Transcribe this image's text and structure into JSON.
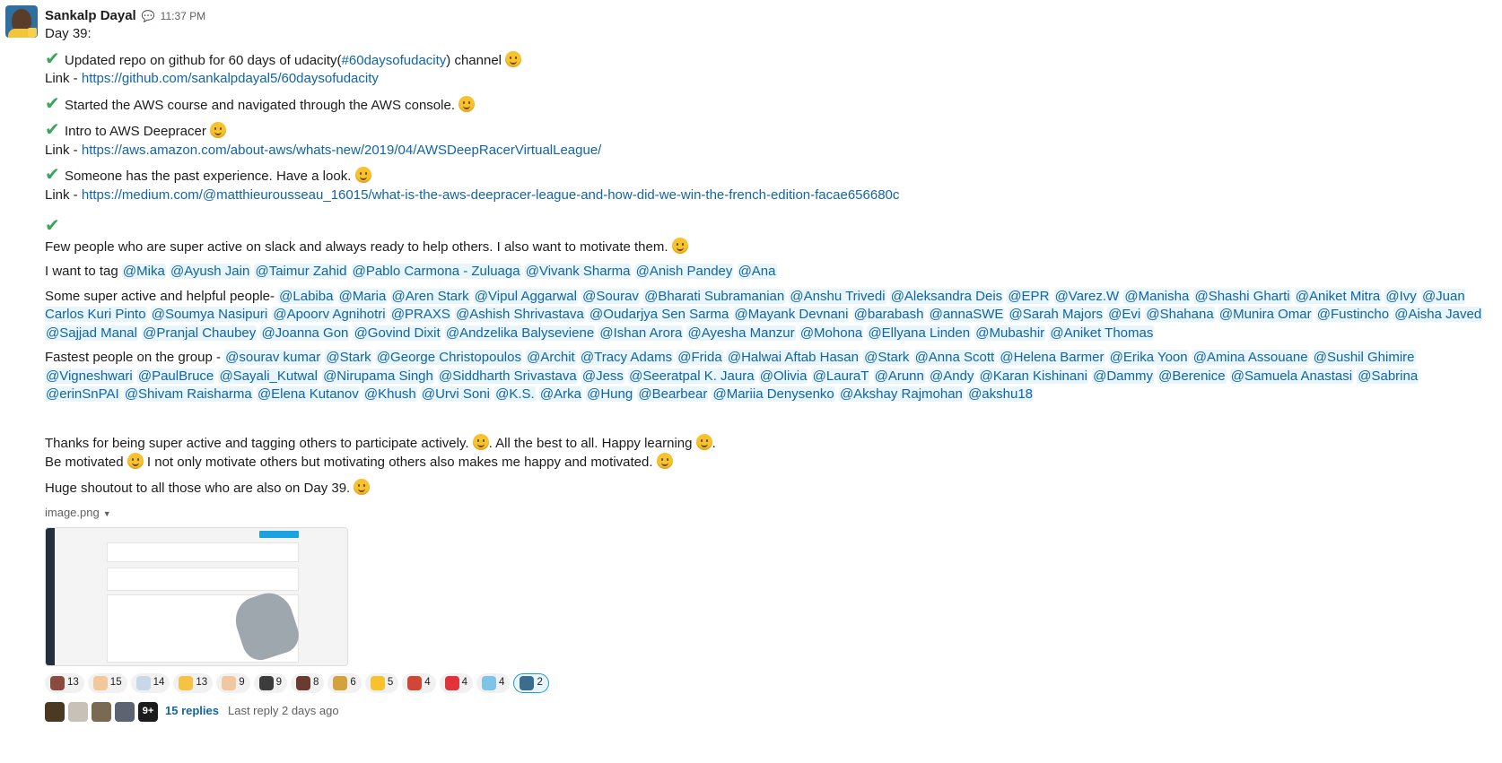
{
  "author": "Sankalp Dayal",
  "time": "11:37 PM",
  "day": "Day 39:",
  "lines": {
    "l1a": "Updated repo on github for 60 days of udacity(",
    "l1chan": "#60daysofudacity",
    "l1b": ")  channel",
    "link_label": "Link - ",
    "link1": "https://github.com/sankalpdayal5/60daysofudacity",
    "l2": "Started the AWS course and navigated through the AWS console.",
    "l3": "Intro to AWS Deepracer",
    "link2": "https://aws.amazon.com/about-aws/whats-new/2019/04/AWSDeepRacerVirtualLeague/",
    "l4": "Someone has the past experience. Have a look.",
    "link3": "https://medium.com/@matthieurousseau_16015/what-is-the-aws-deepracer-league-and-how-did-we-win-the-french-edition-facae656680c",
    "l5": "Few people who are super active on slack and always ready to help others. I also want to motivate them.",
    "tag_intro": "I want to tag",
    "helpful_intro": "Some super active and helpful people-",
    "fastest_intro": "Fastest people on the group -",
    "thanks_a": "Thanks for being super active and tagging others to participate actively.",
    "thanks_b": ". All the best to all. Happy learning",
    "thanks_c": ".",
    "motivated_a": "Be motivated",
    "motivated_b": " I not only motivate others but motivating others also makes me happy and motivated.",
    "shoutout": "Huge shoutout to all those who are also on Day 39."
  },
  "tags": [
    "@Mika",
    "@Ayush Jain",
    "@Taimur Zahid",
    "@Pablo Carmona - Zuluaga",
    "@Vivank Sharma",
    "@Anish Pandey",
    "@Ana"
  ],
  "helpful": [
    "@Labiba",
    "@Maria",
    "@Aren Stark",
    "@Vipul Aggarwal",
    "@Sourav",
    "@Bharati Subramanian",
    "@Anshu Trivedi",
    "@Aleksandra Deis",
    "@EPR",
    "@Varez.W",
    "@Manisha",
    "@Shashi Gharti",
    "@Aniket Mitra",
    "@Ivy",
    "@Juan Carlos Kuri Pinto",
    "@Soumya Nasipuri",
    "@Apoorv Agnihotri",
    "@PRAXS",
    "@Ashish Shrivastava",
    "@Oudarjya Sen Sarma",
    "@Mayank Devnani",
    "@barabash",
    "@annaSWE",
    "@Sarah Majors",
    "@Evi",
    "@Shahana",
    "@Munira Omar",
    "@Fustincho",
    "@Aisha Javed",
    "@Sajjad Manal",
    "@Pranjal Chaubey",
    "@Joanna Gon",
    "@Govind Dixit",
    "@Andzelika Balyseviene",
    "@Ishan Arora",
    "@Ayesha Manzur",
    "@Mohona",
    "@Ellyana Linden",
    "@Mubashir",
    "@Aniket Thomas"
  ],
  "fastest": [
    "@sourav kumar",
    "@Stark",
    "@George Christopoulos",
    "@Archit",
    "@Tracy Adams",
    "@Frida",
    "@Halwai Aftab Hasan",
    "@Stark",
    "@Anna Scott",
    "@Helena Barmer",
    "@Erika Yoon",
    "@Amina Assouane",
    "@Sushil Ghimire",
    "@Vigneshwari",
    "@PaulBruce",
    "@Sayali_Kutwal",
    "@Nirupama Singh",
    "@Siddharth Srivastava",
    "@Jess",
    "@Seeratpal K. Jaura",
    "@Olivia",
    "@LauraT",
    "@Arunn",
    "@Andy",
    "@Karan Kishinani",
    "@Dammy",
    "@Berenice",
    "@Samuela Anastasi",
    "@Sabrina",
    "@erinSnPAI",
    "@Shivam Raisharma",
    "@Elena Kutanov",
    "@Khush",
    "@Urvi Soni",
    "@K.S.",
    "@Arka",
    "@Hung",
    "@Bearbear",
    "@Mariia Denysenko",
    "@Akshay Rajmohan",
    "@akshu18"
  ],
  "file_name": "image.png",
  "reactions": [
    {
      "count": "13",
      "color": "#8a4b3c",
      "icon": "racecar-icon"
    },
    {
      "count": "15",
      "color": "#f3c89a",
      "icon": "thumbsup-light-icon"
    },
    {
      "count": "14",
      "color": "#c9d8e6",
      "icon": "rocket-icon"
    },
    {
      "count": "13",
      "color": "#f6c244",
      "icon": "thumbsup-icon"
    },
    {
      "count": "9",
      "color": "#f0c7a0",
      "icon": "clap-icon"
    },
    {
      "count": "9",
      "color": "#3c3c3c",
      "icon": "penguin-icon"
    },
    {
      "count": "8",
      "color": "#6b3b30",
      "icon": "racecar-icon"
    },
    {
      "count": "6",
      "color": "#d4a23c",
      "icon": "dancer-icon"
    },
    {
      "count": "5",
      "color": "#f7c22d",
      "icon": "grin-icon"
    },
    {
      "count": "4",
      "color": "#d0473a",
      "icon": "car-icon"
    },
    {
      "count": "4",
      "color": "#e0343a",
      "icon": "heart-icon"
    },
    {
      "count": "4",
      "color": "#7cc4e8",
      "icon": "thankyou-icon"
    },
    {
      "count": "2",
      "color": "#3a6e8f",
      "icon": "custom-avatar-icon",
      "active": true
    }
  ],
  "thread": {
    "more": "9+",
    "replies": "15 replies",
    "last": "Last reply 2 days ago"
  }
}
